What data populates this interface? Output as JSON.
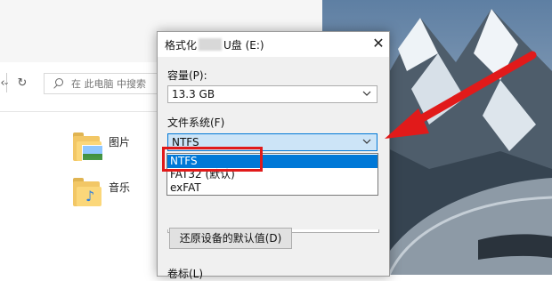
{
  "explorer": {
    "back_icon": "back-arrow-icon",
    "dropdown_icon": "chevron-down-icon",
    "refresh_icon": "refresh-icon",
    "search_placeholder": "在 此电脑 中搜索",
    "folders": [
      {
        "label": "图片",
        "icon": "pictures-folder-icon"
      },
      {
        "label": "音乐",
        "icon": "music-folder-icon"
      }
    ]
  },
  "dialog": {
    "title_prefix": "格式化",
    "title_suffix": "U盘 (E:)",
    "close_glyph": "✕",
    "capacity": {
      "label": "容量(P):",
      "value": "13.3 GB"
    },
    "filesystem": {
      "label": "文件系统(F)",
      "value": "NTFS",
      "options": [
        "NTFS",
        "FAT32 (默认)",
        "exFAT"
      ],
      "selected_index": 0
    },
    "restore_button": "还原设备的默认值(D)",
    "volume_label": "卷标(L)"
  },
  "annotation": {
    "color": "#e11a1a"
  }
}
